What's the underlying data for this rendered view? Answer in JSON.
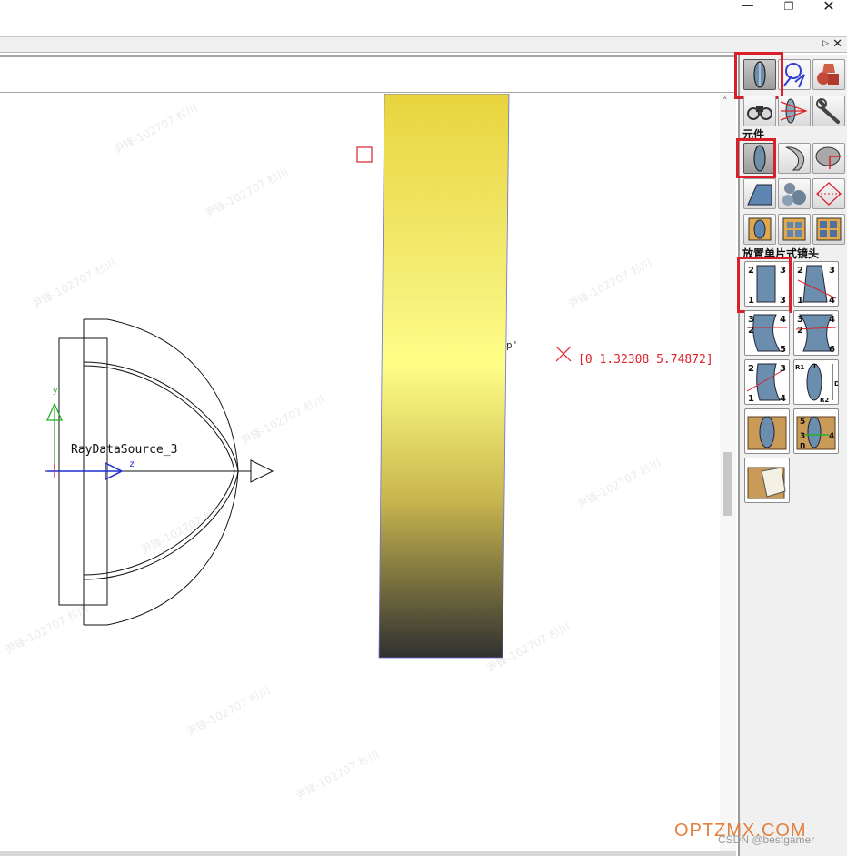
{
  "window": {
    "minimize_glyph": "—",
    "maximize_glyph": "❐",
    "close_glyph": "✕",
    "panel_pin_glyph": "▷",
    "panel_close_glyph": "✕"
  },
  "scrollbar": {
    "up_glyph": "˄"
  },
  "viewport": {
    "source_label": "RayDataSource_3",
    "z_axis_label": "z",
    "y_axis_label": "y",
    "coordinate_readout": "[0  1.32308  5.74872]",
    "stray_text": "p'",
    "lens_gradient": [
      "#e8d43e",
      "#f6f07a",
      "#ffff86",
      "#c8b64e",
      "#303030"
    ]
  },
  "palette": {
    "section_components": "元件",
    "section_single_lens": "放置单片式镜头",
    "top_tools": [
      "lens-tool",
      "probe-tool",
      "solids-tool",
      "binoculars-tool",
      "raytrace-tool",
      "wrench-tool"
    ],
    "component_tools": [
      "lens-element-tool",
      "mirror-tool",
      "surface-tool",
      "prism-tool",
      "spheres-tool",
      "aperture-tool",
      "block-tool",
      "grid-block-tool",
      "multi-block-tool"
    ],
    "single_lens_tools": [
      {
        "icon": "plano-lens-4pt-icon",
        "corner_labels": [
          "2",
          "3",
          "1",
          "3"
        ]
      },
      {
        "icon": "wedge-lens-4pt-icon",
        "corner_labels": [
          "2",
          "3",
          "1",
          "4"
        ]
      },
      {
        "icon": "bent-lens-5pt-icon",
        "corner_labels": [
          "3",
          "4",
          "2",
          "5"
        ]
      },
      {
        "icon": "concave-lens-6pt-icon",
        "corner_labels": [
          "3",
          "4",
          "2",
          "6"
        ]
      },
      {
        "icon": "tilted-lens-4pt-icon",
        "corner_labels": [
          "2",
          "3",
          "1",
          "4"
        ]
      },
      {
        "icon": "radius-lens-icon",
        "corner_labels": [
          "R1",
          "T",
          "R2",
          "D"
        ]
      },
      {
        "icon": "lens-folder-icon",
        "corner_labels": []
      },
      {
        "icon": "multi-lens-folder-icon",
        "corner_labels": [
          "5",
          "3",
          "n",
          "4"
        ]
      },
      {
        "icon": "open-folder-icon",
        "corner_labels": []
      }
    ]
  },
  "footer": {
    "brand": "OPTZMX.COM",
    "credit": "CSDN @bestgamer"
  },
  "watermark": "尹锋-102707 杉川",
  "colors": {
    "highlight": "#d9202a",
    "axis_y": "#22b02a",
    "axis_z": "#1f2fd0",
    "readout": "#e0202a",
    "brand": "#e2813f"
  }
}
